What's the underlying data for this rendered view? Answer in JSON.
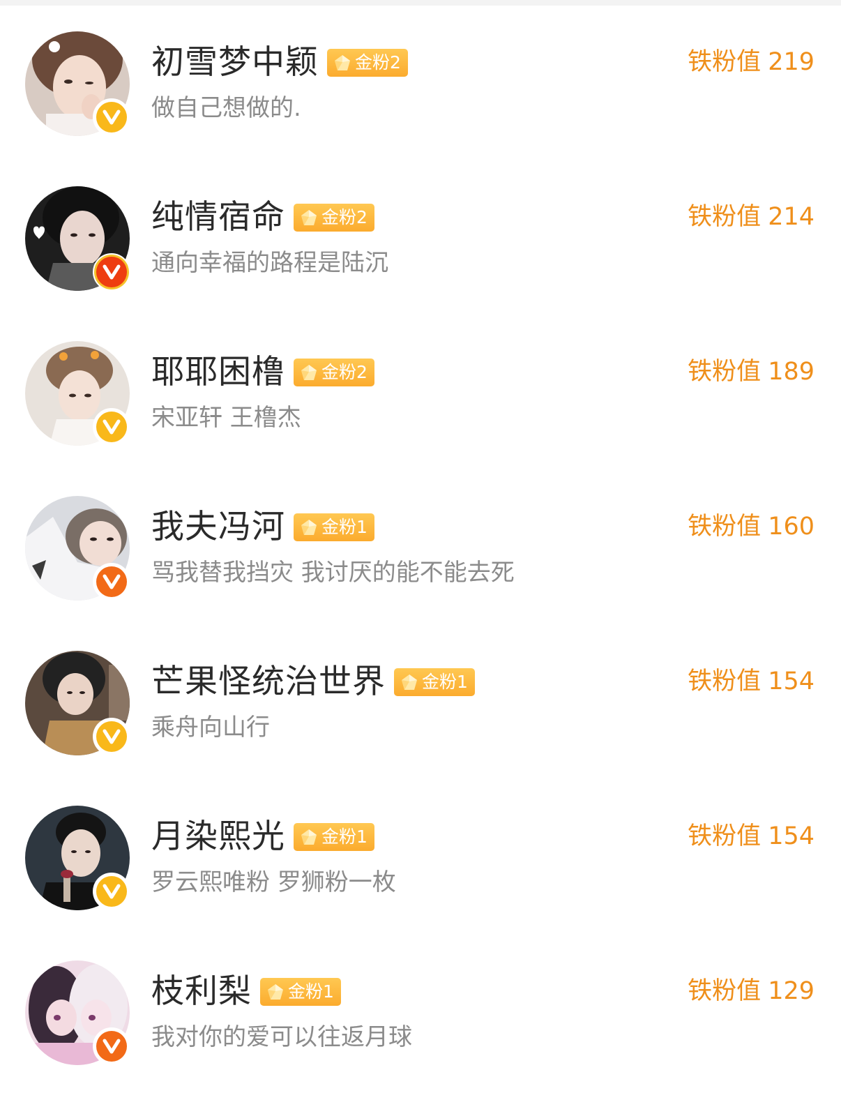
{
  "fans": [
    {
      "name": "初雪梦中颖",
      "badge": "金粉2",
      "bio": "做自己想做的.",
      "fan_label": "铁粉值",
      "fan_value": "219",
      "verify": "gold"
    },
    {
      "name": "纯情宿命",
      "badge": "金粉2",
      "bio": "通向幸福的路程是陆沉",
      "fan_label": "铁粉值",
      "fan_value": "214",
      "verify": "red"
    },
    {
      "name": "耶耶困橹",
      "badge": "金粉2",
      "bio": "宋亚轩 王橹杰",
      "fan_label": "铁粉值",
      "fan_value": "189",
      "verify": "gold"
    },
    {
      "name": "我夫冯河",
      "badge": "金粉1",
      "bio": "骂我替我挡灾 我讨厌的能不能去死",
      "fan_label": "铁粉值",
      "fan_value": "160",
      "verify": "orange"
    },
    {
      "name": "芒果怪统治世界",
      "badge": "金粉1",
      "bio": "乘舟向山行",
      "fan_label": "铁粉值",
      "fan_value": "154",
      "verify": "gold"
    },
    {
      "name": "月染熙光",
      "badge": "金粉1",
      "bio": "罗云熙唯粉 罗狮粉一枚",
      "fan_label": "铁粉值",
      "fan_value": "154",
      "verify": "gold"
    },
    {
      "name": "枝利梨",
      "badge": "金粉1",
      "bio": "我对你的爱可以往返月球",
      "fan_label": "铁粉值",
      "fan_value": "129",
      "verify": "orange"
    }
  ],
  "colors": {
    "fan_value": "#ef8f1b",
    "badge": "#fbab2e",
    "verify_gold": "#f9b81a",
    "verify_orange": "#f26a17",
    "verify_red": "#ee3d10"
  },
  "icons": {
    "verify": "v-verified-icon",
    "badge_gem": "gem-icon"
  }
}
